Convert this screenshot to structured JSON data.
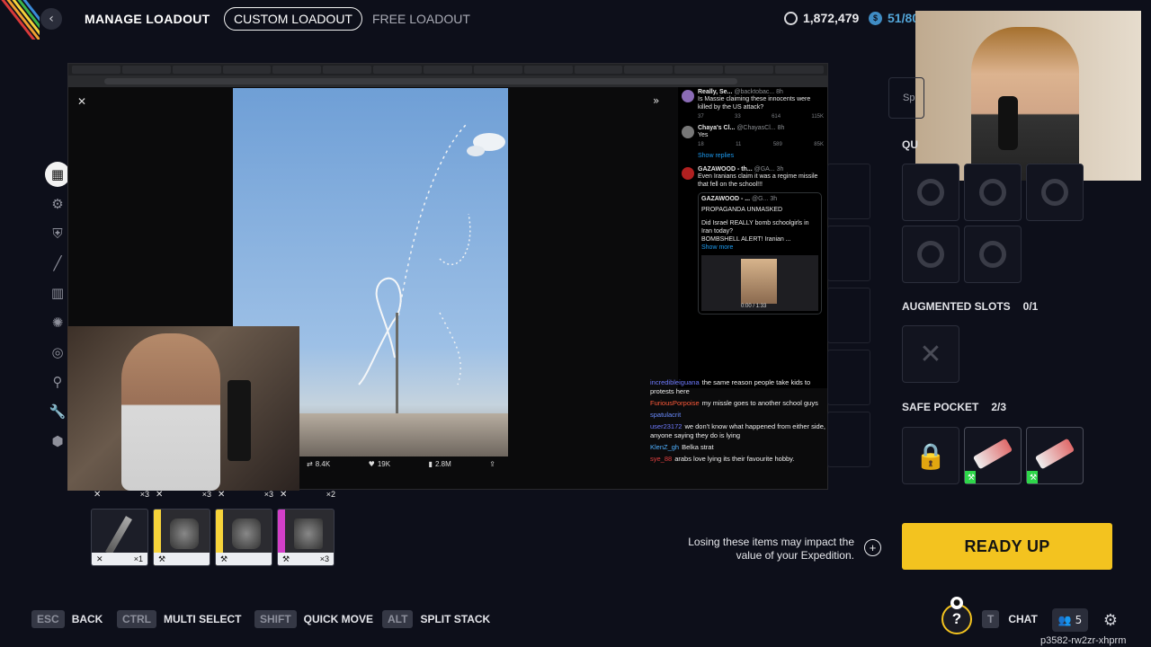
{
  "topbar": {
    "title": "MANAGE LOADOUT",
    "tabs": [
      "CUSTOM LOADOUT",
      "FREE LOADOUT"
    ],
    "currency_a": "1,872,479",
    "currency_b": "51/80"
  },
  "browser": {
    "stats": {
      "reposts": "8.4K",
      "likes": "19K",
      "views": "2.8M"
    },
    "tweets": [
      {
        "name": "Really, Se...",
        "handle": "@backtobac...",
        "time": "8h",
        "text": "Is Massie claiming these innocents were killed by the US attack?",
        "acts": [
          "37",
          "33",
          "614",
          "115K"
        ]
      },
      {
        "name": "Chaya's Cl...",
        "handle": "@ChayasCl...",
        "time": "8h",
        "text": "Yes",
        "acts": [
          "18",
          "11",
          "589",
          "85K"
        ]
      },
      {
        "name": "GAZAWOOD - th...",
        "handle": "@GA...",
        "time": "3h",
        "text": "Even Iranians claim it was a regime missile that fell on the school!!!",
        "acts": []
      }
    ],
    "show_replies": "Show replies",
    "quote": {
      "name": "GAZAWOOD - ...",
      "handle": "@G...",
      "time": "3h",
      "line1": "PROPAGANDA UNMASKED",
      "line2": "Did Israel REALLY bomb schoolgirls in Iran today?",
      "line3": "BOMBSHELL ALERT! Iranian ...",
      "show_more": "Show more",
      "video_time": "0:00 / 1:33"
    }
  },
  "chat": [
    {
      "user": "incredibleiguana",
      "color": "#6f7bff",
      "msg": "the same reason people take kids to protests here"
    },
    {
      "user": "FuriousPorpoise",
      "color": "#ff5a3a",
      "msg": "my missle goes to another school guys"
    },
    {
      "user": "spatulacrit",
      "color": "#6a8cff",
      "msg": ""
    },
    {
      "user": "user23172",
      "color": "#6f7bff",
      "msg": "we don't know what happened from either side, anyone saying they do is lying"
    },
    {
      "user": "KlenZ_gh",
      "color": "#4fb0ff",
      "msg": "Belka strat"
    },
    {
      "user": "sye_88",
      "color": "#e24040",
      "msg": "arabs love lying its their favourite hobby."
    }
  ],
  "right_panel": {
    "search_partial": "Sp",
    "quick_label": "QU",
    "augmented_label": "AUGMENTED SLOTS",
    "augmented_count": "0/1",
    "safe_label": "SAFE POCKET",
    "safe_count": "2/3"
  },
  "inventory": [
    {
      "qty_top": "×3",
      "qty_bottom": "×1",
      "rarity": "grey"
    },
    {
      "qty_top": "×3",
      "qty_bottom": "",
      "rarity": "yellow"
    },
    {
      "qty_top": "×3",
      "qty_bottom": "",
      "rarity": "yellow"
    },
    {
      "qty_top": "×2",
      "qty_bottom": "×3",
      "rarity": "magenta"
    }
  ],
  "ready": {
    "warning": "Losing these items may impact the value of your Expedition.",
    "button": "READY UP"
  },
  "footer": {
    "hints": [
      {
        "key": "ESC",
        "label": "BACK"
      },
      {
        "key": "CTRL",
        "label": "MULTI SELECT"
      },
      {
        "key": "SHIFT",
        "label": "QUICK MOVE"
      },
      {
        "key": "ALT",
        "label": "SPLIT STACK"
      }
    ],
    "chat_key": "T",
    "chat_label": "CHAT",
    "party_count": "5",
    "session_code": "p3582-rw2zr-xhprm"
  },
  "colors": {
    "accent": "#f3c31f",
    "safe_green": "#2ed64a",
    "background": "#0d0f1a"
  },
  "icons": [
    "back-arrow-icon",
    "credits-icon",
    "tokens-icon",
    "grid-icon",
    "gear-icon",
    "help-icon",
    "party-icon",
    "plus-icon"
  ]
}
